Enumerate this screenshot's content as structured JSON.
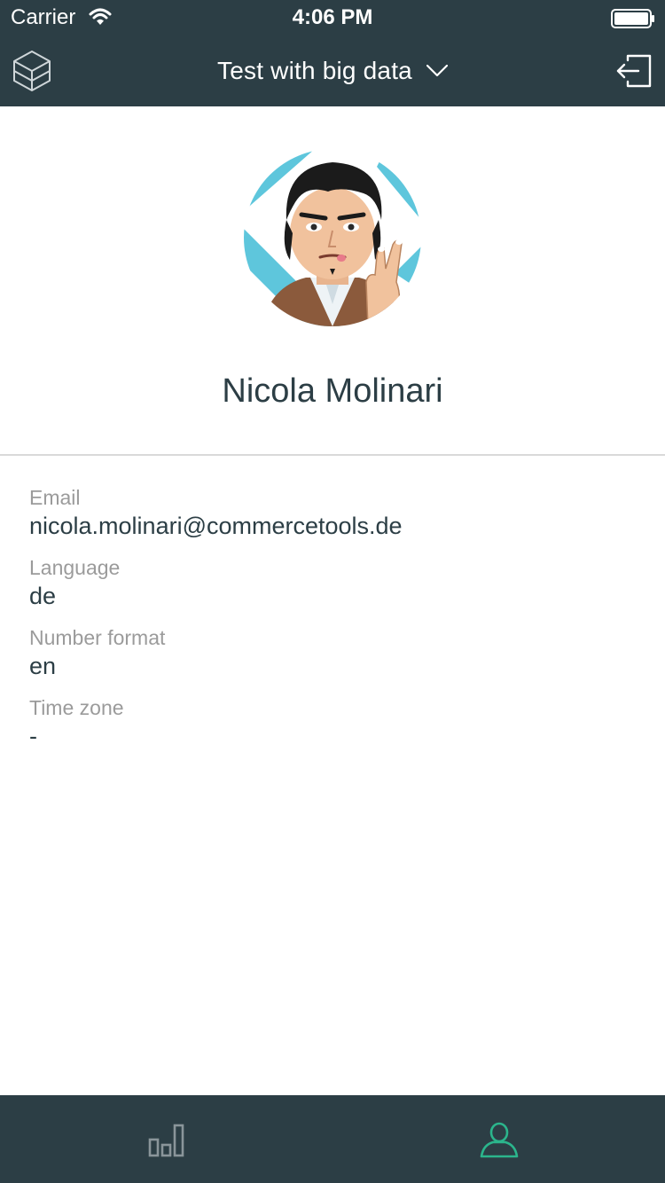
{
  "status_bar": {
    "carrier": "Carrier",
    "time": "4:06 PM"
  },
  "nav": {
    "project_title": "Test with big data",
    "logo_icon": "cube-logo-icon",
    "dropdown_icon": "chevron-down-icon",
    "logout_icon": "logout-icon"
  },
  "profile": {
    "name": "Nicola Molinari",
    "avatar_icon": "avatar-illustration"
  },
  "details": [
    {
      "label": "Email",
      "value": "nicola.molinari@commercetools.de"
    },
    {
      "label": "Language",
      "value": "de"
    },
    {
      "label": "Number format",
      "value": "en"
    },
    {
      "label": "Time zone",
      "value": "-"
    }
  ],
  "tab_bar": {
    "tabs": [
      {
        "name": "dashboard",
        "icon": "bar-chart-icon",
        "active": false
      },
      {
        "name": "account",
        "icon": "person-icon",
        "active": true
      }
    ]
  },
  "colors": {
    "header_bg": "#2c3e45",
    "text_primary": "#2c3e45",
    "label_gray": "#9b9b9b",
    "tab_inactive": "#8a959a",
    "tab_active": "#2bb58c",
    "divider": "#d9d9d9"
  }
}
